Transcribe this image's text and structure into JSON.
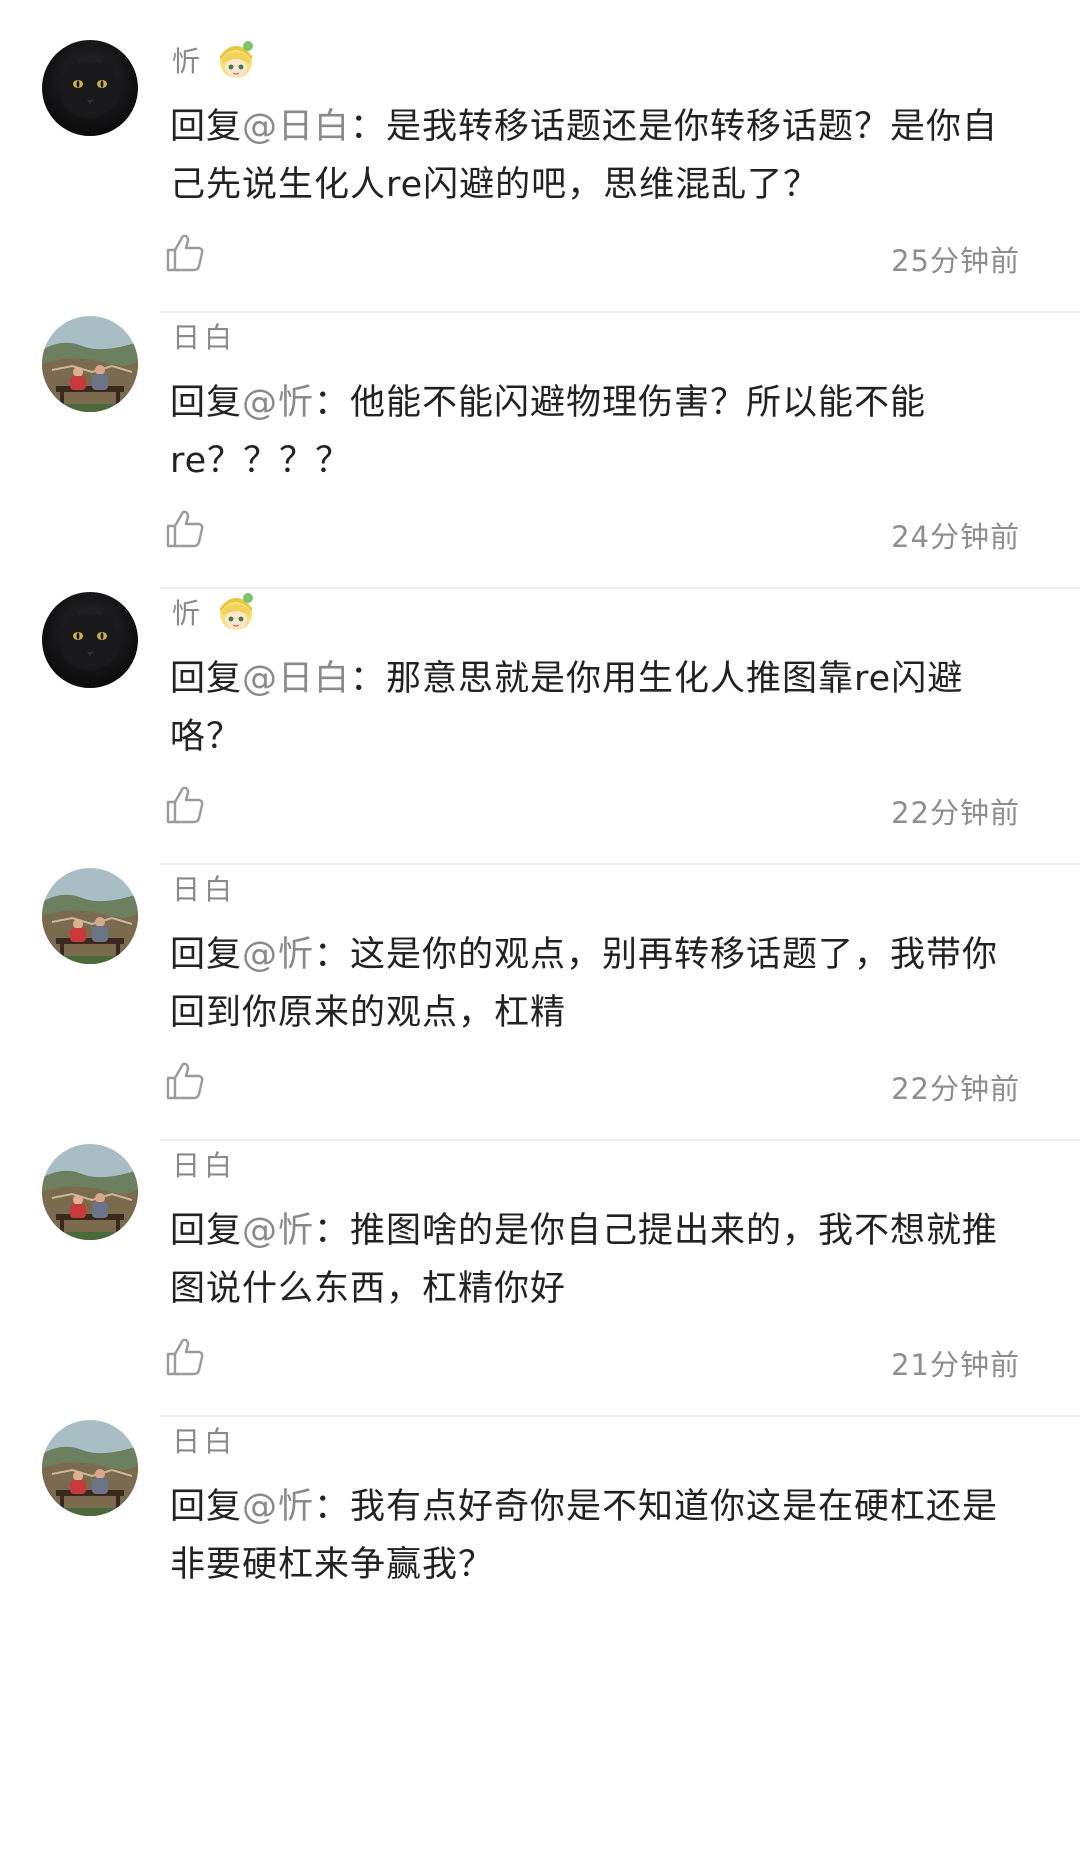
{
  "comments": [
    {
      "username": "忻",
      "avatar_icon": "black-cat-avatar",
      "has_badge": true,
      "badge_icon": "cartoon-girl-badge-icon",
      "reply_prefix": "回复",
      "mention": "@日白",
      "separator": "：",
      "text": "是我转移话题还是你转移话题？是你自己先说生化人re闪避的吧，思维混乱了？",
      "time": "25分钟前"
    },
    {
      "username": "日白",
      "avatar_icon": "landscape-couple-avatar",
      "has_badge": false,
      "reply_prefix": "回复",
      "mention": "@忻",
      "separator": "：",
      "text": "他能不能闪避物理伤害？所以能不能re？？？？",
      "time": "24分钟前"
    },
    {
      "username": "忻",
      "avatar_icon": "black-cat-avatar",
      "has_badge": true,
      "badge_icon": "cartoon-girl-badge-icon",
      "reply_prefix": "回复",
      "mention": "@日白",
      "separator": "：",
      "text": "那意思就是你用生化人推图靠re闪避咯？",
      "time": "22分钟前"
    },
    {
      "username": "日白",
      "avatar_icon": "landscape-couple-avatar",
      "has_badge": false,
      "reply_prefix": "回复",
      "mention": "@忻",
      "separator": "：",
      "text": "这是你的观点，别再转移话题了，我带你回到你原来的观点，杠精",
      "time": "22分钟前"
    },
    {
      "username": "日白",
      "avatar_icon": "landscape-couple-avatar",
      "has_badge": false,
      "reply_prefix": "回复",
      "mention": "@忻",
      "separator": "：",
      "text": "推图啥的是你自己提出来的，我不想就推图说什么东西，杠精你好",
      "time": "21分钟前"
    },
    {
      "username": "日白",
      "avatar_icon": "landscape-couple-avatar",
      "has_badge": false,
      "reply_prefix": "回复",
      "mention": "@忻",
      "separator": "：",
      "text": "我有点好奇你是不知道你这是在硬杠还是非要硬杠来争赢我？",
      "time": ""
    }
  ],
  "colors": {
    "text": "#222222",
    "muted": "#8a8a8a",
    "divider": "#ededed",
    "background": "#ffffff"
  }
}
